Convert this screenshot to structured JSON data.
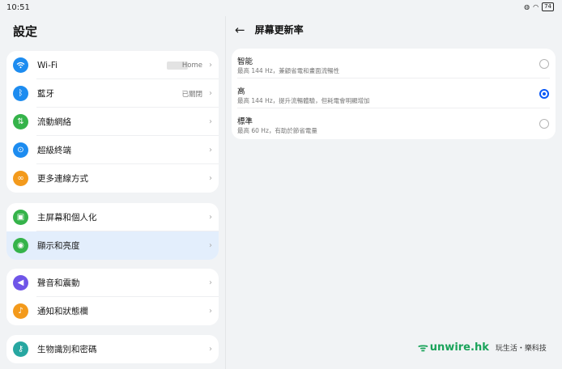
{
  "status": {
    "time": "10:51",
    "battery": "74"
  },
  "left": {
    "title": "設定",
    "groups": [
      [
        {
          "label": "Wi-Fi",
          "value": "Home",
          "icon": "wifi-icon",
          "color": "#1d8cf0"
        },
        {
          "label": "藍牙",
          "value": "已關閉",
          "icon": "bluetooth-icon",
          "color": "#1d8cf0"
        },
        {
          "label": "流動網絡",
          "value": "",
          "icon": "mobile-data-icon",
          "color": "#35b34a"
        },
        {
          "label": "超級終端",
          "value": "",
          "icon": "super-device-icon",
          "color": "#1d8cf0"
        },
        {
          "label": "更多連線方式",
          "value": "",
          "icon": "link-icon",
          "color": "#f39a1c"
        }
      ],
      [
        {
          "label": "主屏幕和個人化",
          "value": "",
          "icon": "wallpaper-icon",
          "color": "#35b34a"
        },
        {
          "label": "顯示和亮度",
          "value": "",
          "icon": "eye-icon",
          "color": "#35b34a"
        }
      ],
      [
        {
          "label": "聲音和震動",
          "value": "",
          "icon": "speaker-icon",
          "color": "#6f55e8"
        },
        {
          "label": "通知和狀態欄",
          "value": "",
          "icon": "bell-icon",
          "color": "#f39a1c"
        }
      ],
      [
        {
          "label": "生物識別和密碼",
          "value": "",
          "icon": "key-icon",
          "color": "#27a7a1"
        }
      ]
    ]
  },
  "right": {
    "title": "屏幕更新率",
    "options": [
      {
        "name": "智能",
        "desc": "最高 144 Hz，兼顧省電和畫面流暢性",
        "selected": false
      },
      {
        "name": "高",
        "desc": "最高 144 Hz，提升流暢體驗，但耗電會明顯增加",
        "selected": true
      },
      {
        "name": "標準",
        "desc": "最高 60 Hz，有助於節省電量",
        "selected": false
      }
    ]
  },
  "watermark": {
    "brand": "unwire.hk",
    "tagline": "玩生活・樂科技"
  }
}
